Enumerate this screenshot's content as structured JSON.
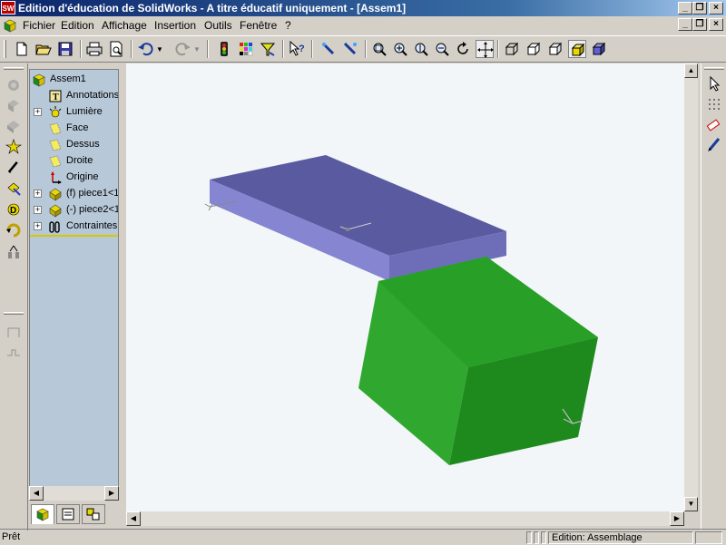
{
  "window": {
    "title": "Edition d'éducation de SolidWorks - A titre éducatif uniquement - [Assem1]",
    "app_icon_text": "SW"
  },
  "menu": [
    "Fichier",
    "Edition",
    "Affichage",
    "Insertion",
    "Outils",
    "Fenêtre",
    "?"
  ],
  "feature_tree": {
    "root": "Assem1",
    "items": [
      {
        "label": "Annotations",
        "expandable": false
      },
      {
        "label": "Lumière",
        "expandable": true
      },
      {
        "label": "Face",
        "expandable": false
      },
      {
        "label": "Dessus",
        "expandable": false
      },
      {
        "label": "Droite",
        "expandable": false
      },
      {
        "label": "Origine",
        "expandable": false
      },
      {
        "label": "(f) piece1<1",
        "expandable": true
      },
      {
        "label": "(-) piece2<1",
        "expandable": true
      },
      {
        "label": "Contraintes",
        "expandable": true
      }
    ]
  },
  "viewport": {
    "slab_colors": {
      "top": "#5a5aa0",
      "front": "#8585d2",
      "side": "#6e6eb8"
    },
    "cube_colors": {
      "left": "#30a830",
      "right": "#1e8a1e",
      "top": "#28a028"
    }
  },
  "status": {
    "left": "Prêt",
    "mode": "Edition: Assemblage"
  }
}
